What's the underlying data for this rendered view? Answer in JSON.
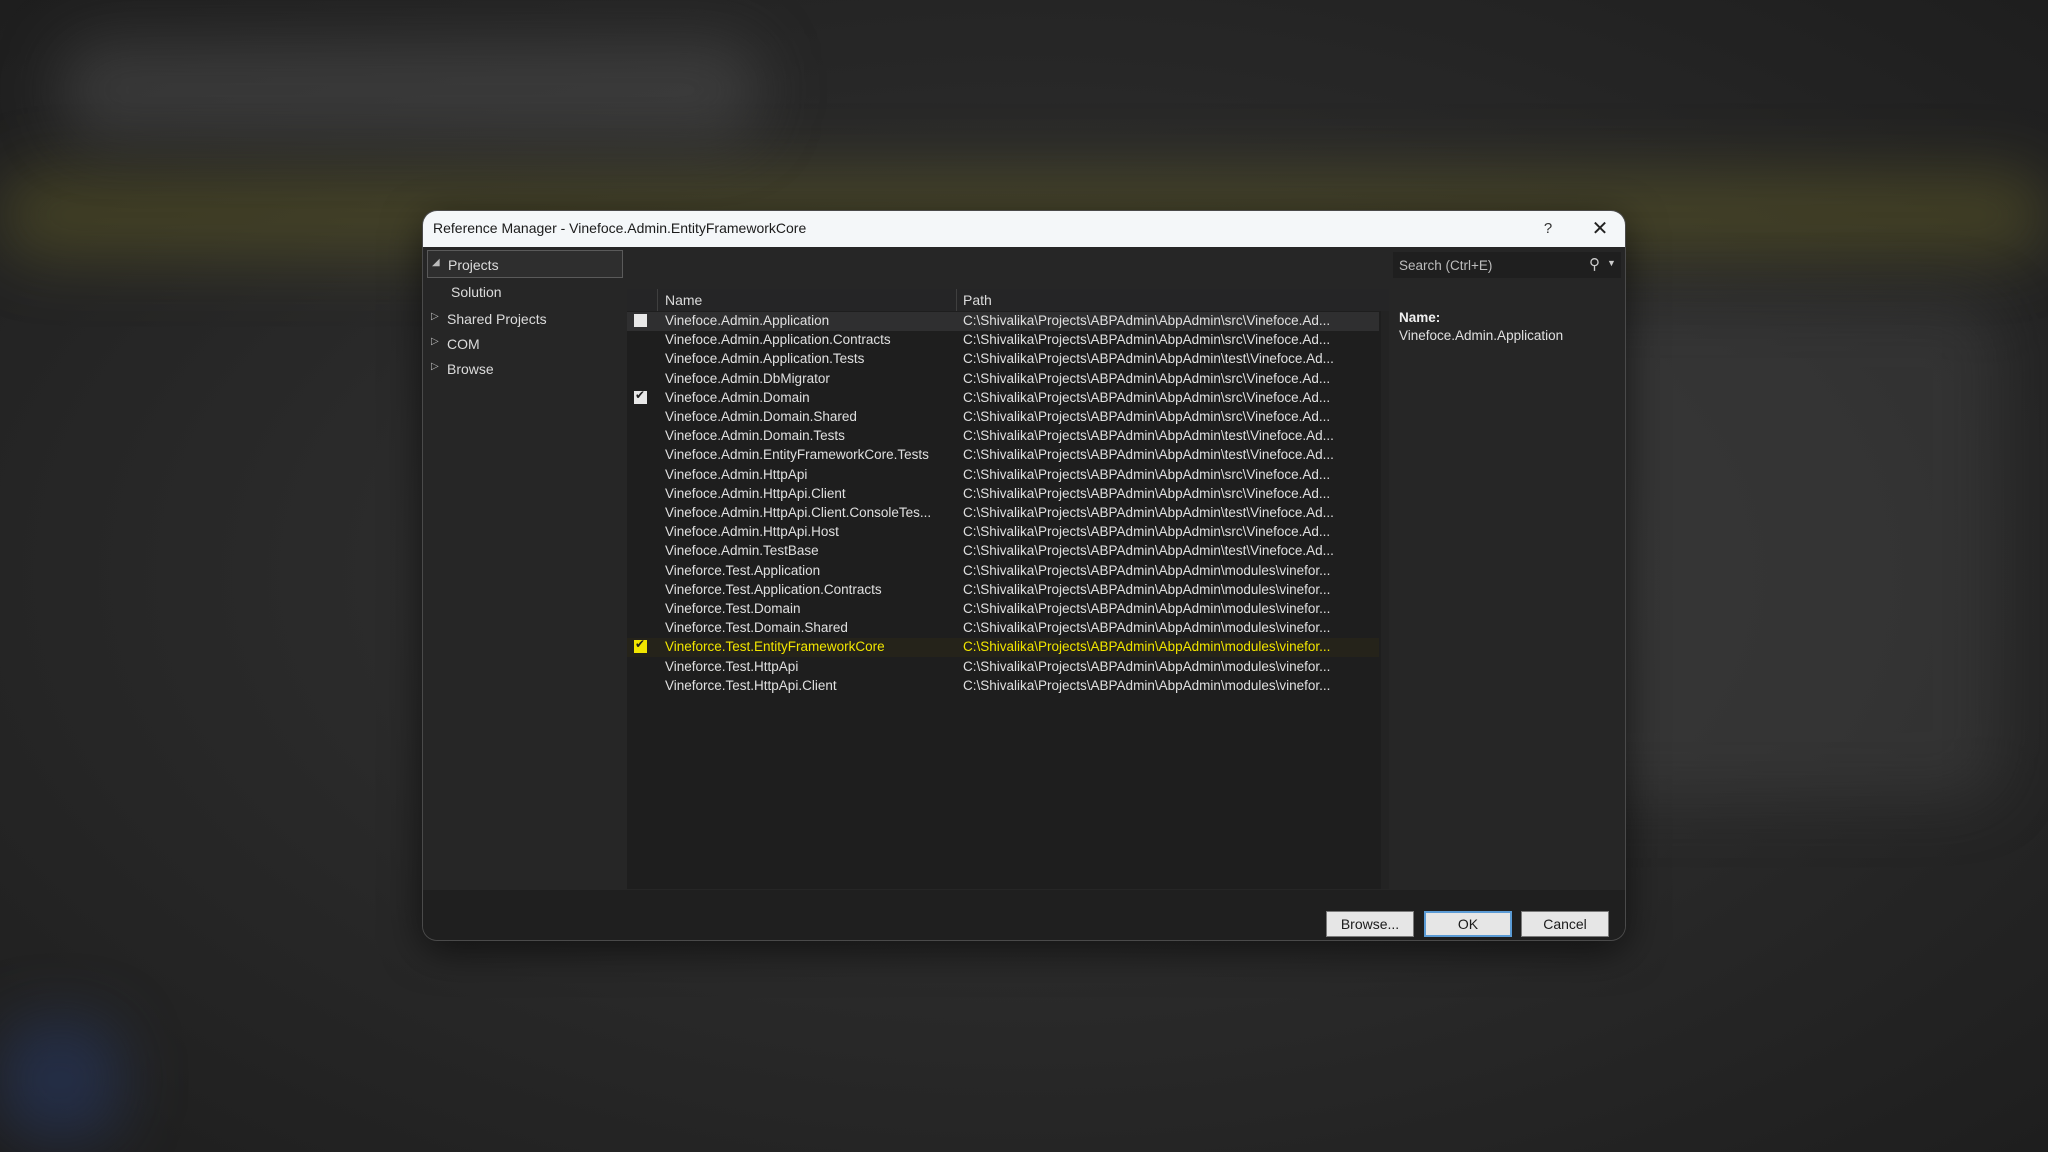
{
  "window": {
    "title": "Reference Manager - Vinefoce.Admin.EntityFrameworkCore",
    "help_label": "?",
    "close_label": "✕"
  },
  "sidebar": {
    "items": [
      {
        "label": "Projects",
        "arrow": "◢",
        "selected": true
      },
      {
        "label": "Solution",
        "arrow": "",
        "selected": false
      },
      {
        "label": "Shared Projects",
        "arrow": "▷",
        "selected": false
      },
      {
        "label": "COM",
        "arrow": "▷",
        "selected": false
      },
      {
        "label": "Browse",
        "arrow": "▷",
        "selected": false
      }
    ]
  },
  "list": {
    "columns": {
      "name": "Name",
      "path": "Path"
    },
    "rows": [
      {
        "name": "Vinefoce.Admin.Application",
        "path": "C:\\Shivalika\\Projects\\ABPAdmin\\AbpAdmin\\src\\Vinefoce.Ad...",
        "checked": "off"
      },
      {
        "name": "Vinefoce.Admin.Application.Contracts",
        "path": "C:\\Shivalika\\Projects\\ABPAdmin\\AbpAdmin\\src\\Vinefoce.Ad...",
        "checked": ""
      },
      {
        "name": "Vinefoce.Admin.Application.Tests",
        "path": "C:\\Shivalika\\Projects\\ABPAdmin\\AbpAdmin\\test\\Vinefoce.Ad...",
        "checked": ""
      },
      {
        "name": "Vinefoce.Admin.DbMigrator",
        "path": "C:\\Shivalika\\Projects\\ABPAdmin\\AbpAdmin\\src\\Vinefoce.Ad...",
        "checked": ""
      },
      {
        "name": "Vinefoce.Admin.Domain",
        "path": "C:\\Shivalika\\Projects\\ABPAdmin\\AbpAdmin\\src\\Vinefoce.Ad...",
        "checked": "on"
      },
      {
        "name": "Vinefoce.Admin.Domain.Shared",
        "path": "C:\\Shivalika\\Projects\\ABPAdmin\\AbpAdmin\\src\\Vinefoce.Ad...",
        "checked": ""
      },
      {
        "name": "Vinefoce.Admin.Domain.Tests",
        "path": "C:\\Shivalika\\Projects\\ABPAdmin\\AbpAdmin\\test\\Vinefoce.Ad...",
        "checked": ""
      },
      {
        "name": "Vinefoce.Admin.EntityFrameworkCore.Tests",
        "path": "C:\\Shivalika\\Projects\\ABPAdmin\\AbpAdmin\\test\\Vinefoce.Ad...",
        "checked": ""
      },
      {
        "name": "Vinefoce.Admin.HttpApi",
        "path": "C:\\Shivalika\\Projects\\ABPAdmin\\AbpAdmin\\src\\Vinefoce.Ad...",
        "checked": ""
      },
      {
        "name": "Vinefoce.Admin.HttpApi.Client",
        "path": "C:\\Shivalika\\Projects\\ABPAdmin\\AbpAdmin\\src\\Vinefoce.Ad...",
        "checked": ""
      },
      {
        "name": "Vinefoce.Admin.HttpApi.Client.ConsoleTes...",
        "path": "C:\\Shivalika\\Projects\\ABPAdmin\\AbpAdmin\\test\\Vinefoce.Ad...",
        "checked": ""
      },
      {
        "name": "Vinefoce.Admin.HttpApi.Host",
        "path": "C:\\Shivalika\\Projects\\ABPAdmin\\AbpAdmin\\src\\Vinefoce.Ad...",
        "checked": ""
      },
      {
        "name": "Vinefoce.Admin.TestBase",
        "path": "C:\\Shivalika\\Projects\\ABPAdmin\\AbpAdmin\\test\\Vinefoce.Ad...",
        "checked": ""
      },
      {
        "name": "Vineforce.Test.Application",
        "path": "C:\\Shivalika\\Projects\\ABPAdmin\\AbpAdmin\\modules\\vinefor...",
        "checked": ""
      },
      {
        "name": "Vineforce.Test.Application.Contracts",
        "path": "C:\\Shivalika\\Projects\\ABPAdmin\\AbpAdmin\\modules\\vinefor...",
        "checked": ""
      },
      {
        "name": "Vineforce.Test.Domain",
        "path": "C:\\Shivalika\\Projects\\ABPAdmin\\AbpAdmin\\modules\\vinefor...",
        "checked": ""
      },
      {
        "name": "Vineforce.Test.Domain.Shared",
        "path": "C:\\Shivalika\\Projects\\ABPAdmin\\AbpAdmin\\modules\\vinefor...",
        "checked": ""
      },
      {
        "name": "Vineforce.Test.EntityFrameworkCore",
        "path": "C:\\Shivalika\\Projects\\ABPAdmin\\AbpAdmin\\modules\\vinefor...",
        "checked": "yellow"
      },
      {
        "name": "Vineforce.Test.HttpApi",
        "path": "C:\\Shivalika\\Projects\\ABPAdmin\\AbpAdmin\\modules\\vinefor...",
        "checked": ""
      },
      {
        "name": "Vineforce.Test.HttpApi.Client",
        "path": "C:\\Shivalika\\Projects\\ABPAdmin\\AbpAdmin\\modules\\vinefor...",
        "checked": ""
      }
    ]
  },
  "search": {
    "placeholder": "Search (Ctrl+E)",
    "icon": "search-icon"
  },
  "details": {
    "name_label": "Name:",
    "name_value": "Vinefoce.Admin.Application"
  },
  "footer": {
    "browse_label": "Browse...",
    "ok_label": "OK",
    "cancel_label": "Cancel"
  },
  "colors": {
    "highlight": "#f2e600",
    "accent": "#5b9bd5"
  }
}
